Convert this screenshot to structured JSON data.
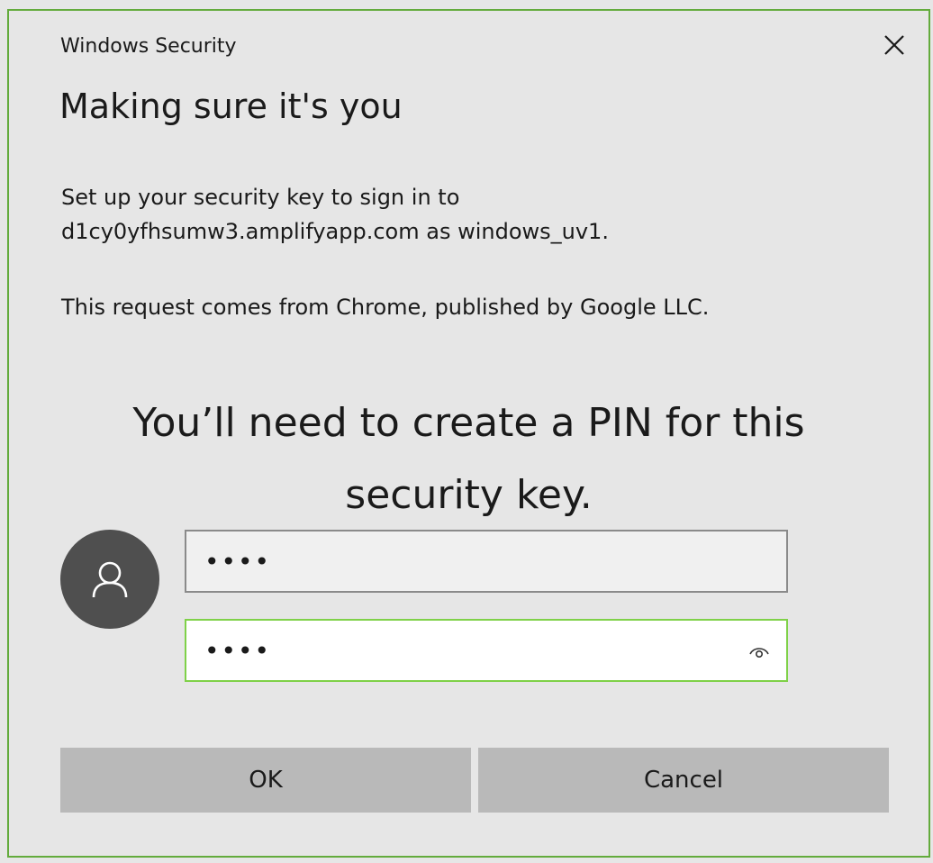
{
  "window": {
    "title": "Windows Security",
    "close_icon": "close-icon"
  },
  "heading": "Making sure it's you",
  "description": {
    "line1": "Set up your security key to sign in to",
    "line2": "d1cy0yfhsumw3.amplifyapp.com as windows_uv1."
  },
  "origin_text": "This request comes from Chrome, published by Google LLC.",
  "pin_prompt": {
    "line1": "You’ll need to create a PIN for this",
    "line2": "security key."
  },
  "avatar_icon": "user-icon",
  "pin": {
    "new_pin_value": "••••",
    "confirm_pin_value": "••••",
    "reveal_icon": "eye-icon"
  },
  "buttons": {
    "ok_label": "OK",
    "cancel_label": "Cancel"
  },
  "colors": {
    "accent_border": "#63ab3c",
    "focus_border": "#7fd148",
    "background": "#e6e6e6",
    "button_bg": "#b9b9b9",
    "avatar_bg": "#4f4f4f"
  }
}
